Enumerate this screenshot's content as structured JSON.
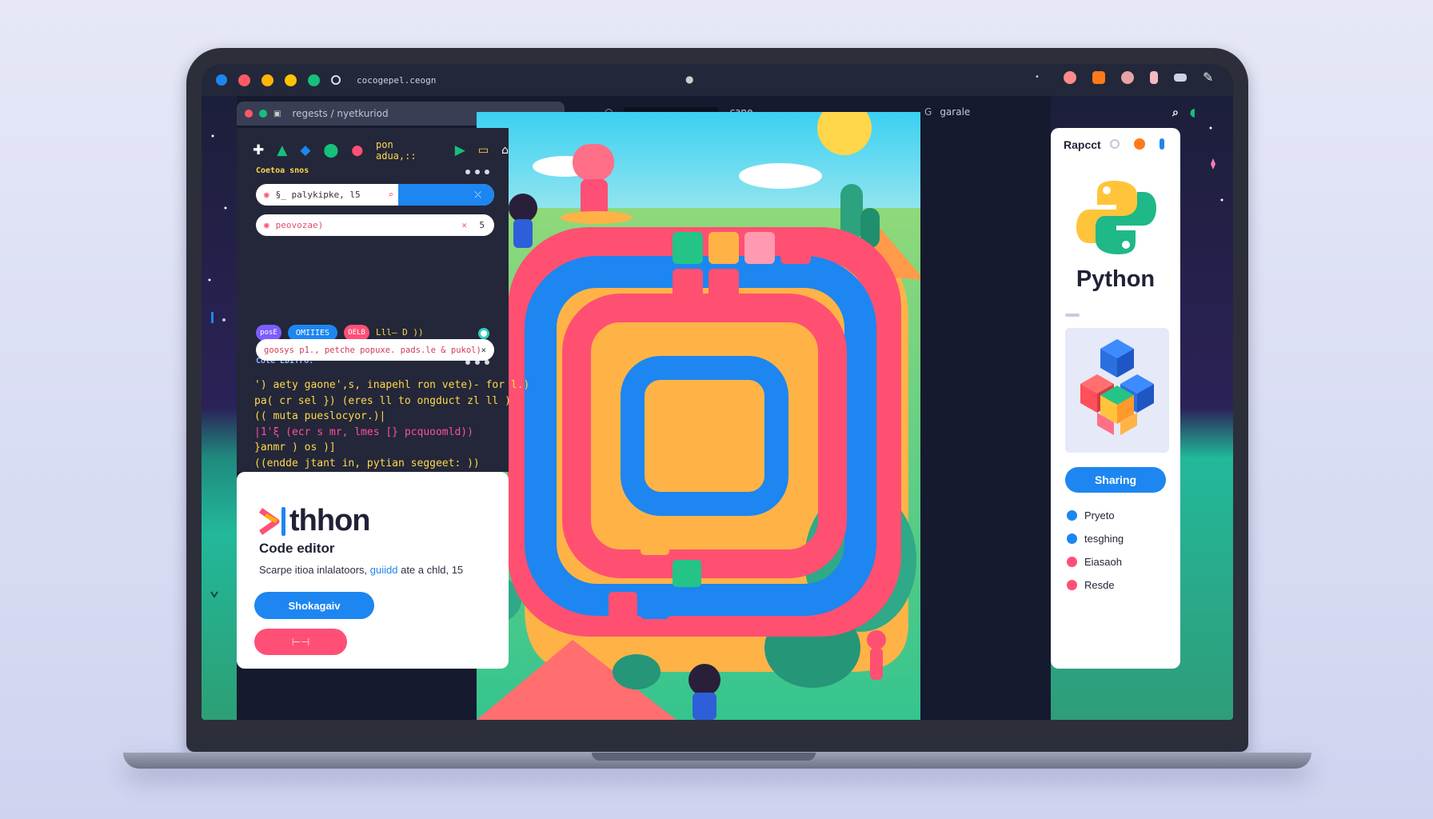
{
  "browser": {
    "url": "cocogepel.ceogn",
    "traffic_colors": [
      "#ff5a64",
      "#ffb400",
      "#ffc400",
      "#16c07a"
    ]
  },
  "tabbar": {
    "breadcrumb": "regests / nyetkuriod",
    "search_mid_label": "cane",
    "search_right_label": "garale"
  },
  "code_panel": {
    "toolbar_text": "pon  adua,::",
    "section1_title": "Coetoa  snos",
    "field1_value": "§_  palykipke,  l5",
    "field2_value": "peovozae)",
    "field2_suffix": "5",
    "chips": [
      "posE",
      "OMIIIES",
      "OELB"
    ],
    "chips_extra": "Lll— D  ))",
    "section2_title": "Cote  EDITro:",
    "field3_value": "goosys  p1.,  petche  popuxe.  pads.le  &  pukol)",
    "code_lines": [
      {
        "text": "') aety gaone',s, inapehl ron vete)- for l.)",
        "color": "#ffd84a"
      },
      {
        "text": "  pa( cr sel }) (eres ll to ongduct zl ll )",
        "color": "#ffd84a"
      },
      {
        "text": "(( muta pueslocyor.)|",
        "color": "#ffd84a"
      },
      {
        "text": "  |1'ξ (ecr s mr, lmes [} pcquoomld))",
        "color": "#ff4f9a"
      },
      {
        "text": "  }anmr ) os )]",
        "color": "#ffd84a"
      },
      {
        "text": "((endde jtant in, pytian seggeet: ))",
        "color": "#ffd84a"
      }
    ]
  },
  "info_card": {
    "logo_word": "thhon",
    "subtitle": "Code editor",
    "desc_part1": "Scarpe itioa inlalatoors,",
    "desc_part2": "guiidd",
    "desc_part3": "ate a chld, 15",
    "primary_button": "Shokagaiv",
    "secondary_button": "⊢⊣"
  },
  "right_panel": {
    "header": "Rapcct",
    "title": "Python",
    "share_button": "Sharing",
    "items": [
      {
        "label": "Pryeto",
        "color": "#1d86f0"
      },
      {
        "label": "tesghing",
        "color": "#1d86f0"
      },
      {
        "label": "Eiasaoh",
        "color": "#ff4f76"
      },
      {
        "label": "Resde",
        "color": "#ff4f76"
      }
    ]
  },
  "colors": {
    "accent_blue": "#1d86f0",
    "accent_pink": "#ff4f76",
    "accent_yellow": "#ffd84a",
    "panel_dark": "#232739"
  }
}
